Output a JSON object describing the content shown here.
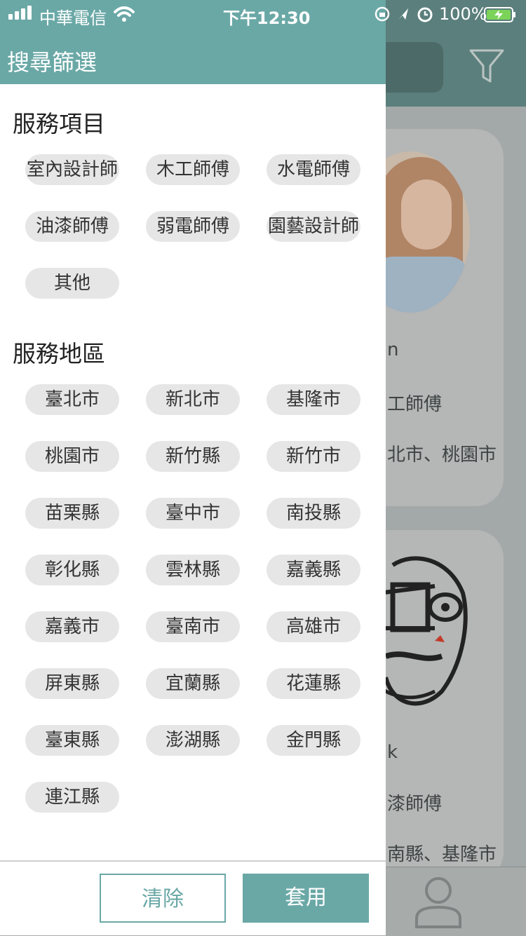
{
  "status_bar": {
    "carrier": "中華電信",
    "time": "下午12:30",
    "battery": "100%"
  },
  "drawer": {
    "title": "搜尋篩選",
    "service_items": {
      "title": "服務項目",
      "options": [
        "室內設計師",
        "木工師傅",
        "水電師傅",
        "油漆師傅",
        "弱電師傅",
        "園藝設計師",
        "其他"
      ]
    },
    "service_areas": {
      "title": "服務地區",
      "options": [
        "臺北市",
        "新北市",
        "基隆市",
        "桃園市",
        "新竹縣",
        "新竹市",
        "苗栗縣",
        "臺中市",
        "南投縣",
        "彰化縣",
        "雲林縣",
        "嘉義縣",
        "嘉義市",
        "臺南市",
        "高雄市",
        "屏東縣",
        "宜蘭縣",
        "花蓮縣",
        "臺東縣",
        "澎湖縣",
        "金門縣",
        "連江縣"
      ]
    },
    "buttons": {
      "clear": "清除",
      "apply": "套用"
    }
  },
  "background": {
    "card1": {
      "line1": "n",
      "line2": "工師傅",
      "line3": "北市、桃園市"
    },
    "card2": {
      "line1": "k",
      "line2": "漆師傅",
      "line3": "南縣、基隆市"
    }
  },
  "colors": {
    "accent": "#6aa8a6",
    "chip_bg": "#e6e6e6"
  }
}
